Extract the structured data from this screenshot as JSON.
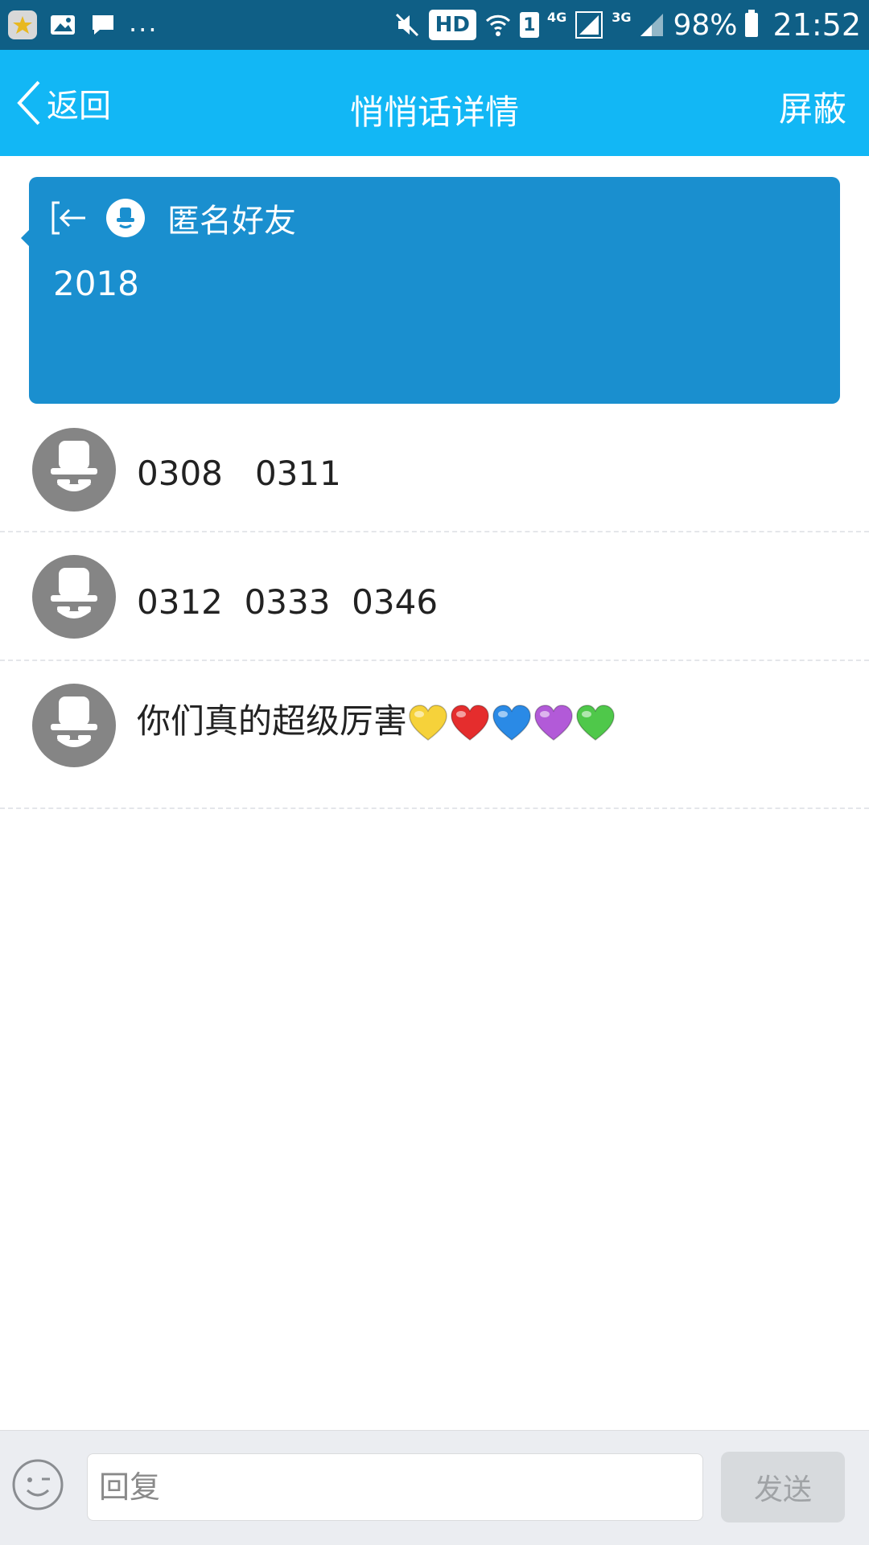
{
  "status_bar": {
    "more": "...",
    "hd": "HD",
    "sim": "1",
    "net_4g": "4G",
    "net_3g": "3G",
    "battery": "98%",
    "time": "21:52"
  },
  "nav": {
    "back_label": "返回",
    "title": "悄悄话详情",
    "block_label": "屏蔽"
  },
  "card": {
    "sender": "匿名好友",
    "message": "2018"
  },
  "replies": [
    {
      "text": "0308   0311"
    },
    {
      "text": "0312  0333  0346"
    },
    {
      "text": "你们真的超级厉害",
      "hearts": [
        "#f6d23a",
        "#e52d2d",
        "#2a8ae6",
        "#b25ad8",
        "#4fc84a"
      ]
    }
  ],
  "input": {
    "placeholder": "回复",
    "value": "",
    "send_label": "发送"
  },
  "colors": {
    "status_bar": "#0f5f86",
    "nav_bar": "#12b7f5",
    "card": "#1a8fcf",
    "avatar": "#858585"
  }
}
